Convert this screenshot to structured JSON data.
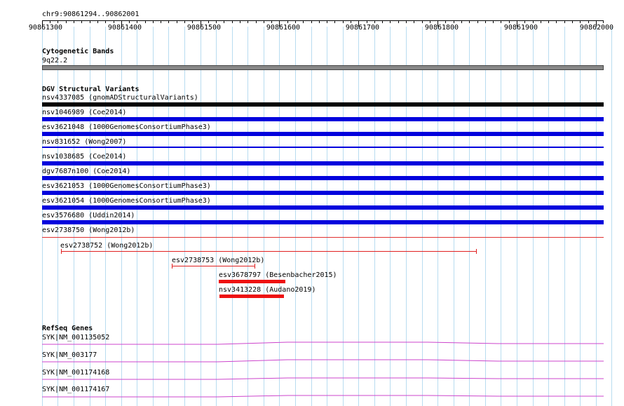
{
  "ruler": {
    "position_label": "chr9:90861294..90862001",
    "ticks": [
      "90861300",
      "90861400",
      "90861500",
      "90861600",
      "90861700",
      "90861800",
      "90861900",
      "90862000"
    ]
  },
  "cytoband_track": {
    "title": "Cytogenetic Bands",
    "band_label": "9q22.2"
  },
  "dgv_track": {
    "title": "DGV Structural Variants",
    "variants": [
      {
        "label": "nsv4337085 (gnomADStructuralVariants)",
        "color": "#000000"
      },
      {
        "label": "nsv1046989 (Coe2014)",
        "color": "#0000dd"
      },
      {
        "label": "esv3621048 (1000GenomesConsortiumPhase3)",
        "color": "#0000dd"
      },
      {
        "label": "nsv831652 (Wong2007)",
        "color": "#0000dd"
      },
      {
        "label": "nsv1038685 (Coe2014)",
        "color": "#0000dd"
      },
      {
        "label": "dgv7687n100 (Coe2014)",
        "color": "#0000dd"
      },
      {
        "label": "esv3621053 (1000GenomesConsortiumPhase3)",
        "color": "#0000dd"
      },
      {
        "label": "esv3621054 (1000GenomesConsortiumPhase3)",
        "color": "#0000dd"
      },
      {
        "label": "esv3576680 (Uddin2014)",
        "color": "#0000dd"
      },
      {
        "label": "esv2738750 (Wong2012b)",
        "color": "#0000dd"
      }
    ],
    "small_variants": [
      {
        "label": "esv2738752 (Wong2012b)",
        "color": "#e02020"
      },
      {
        "label": "esv2738753 (Wong2012b)",
        "color": "#e02020"
      },
      {
        "label": "esv3678797 (Besenbacher2015)",
        "color": "#ee1111"
      },
      {
        "label": "nsv3413228 (Audano2019)",
        "color": "#ee1111"
      }
    ]
  },
  "refseq_track": {
    "title": "RefSeq Genes",
    "genes": [
      "SYK|NM_001135052",
      "SYK|NM_003177",
      "SYK|NM_001174168",
      "SYK|NM_001174167"
    ],
    "gene_color": "#cc44cc"
  }
}
